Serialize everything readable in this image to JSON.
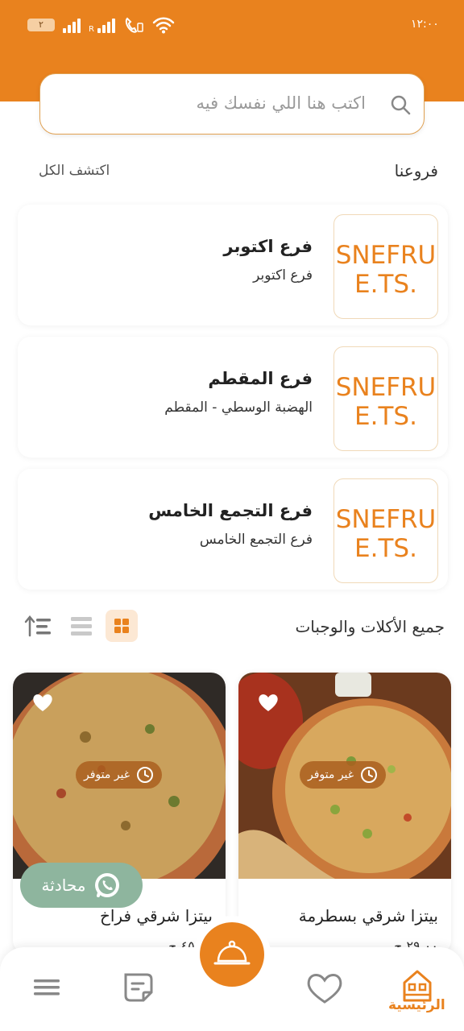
{
  "status_bar": {
    "time": "١٢:٠٠",
    "battery": "٢"
  },
  "search": {
    "placeholder": "اكتب هنا  اللي نفسك فيه"
  },
  "branches_section": {
    "title": "فروعنا",
    "see_all": "اكتشف الكل"
  },
  "branches": [
    {
      "name": "فرع اكتوبر",
      "address": "فرع اكتوبر",
      "logo_line1": "SNEFRU",
      "logo_line2": "E.TS."
    },
    {
      "name": "فرع المقطم",
      "address": "الهضبة الوسطي - المقطم",
      "logo_line1": "SNEFRU",
      "logo_line2": "E.TS."
    },
    {
      "name": "فرع التجمع الخامس",
      "address": "فرع التجمع الخامس",
      "logo_line1": "SNEFRU",
      "logo_line2": "E.TS."
    }
  ],
  "meals_section": {
    "title": "جميع الأكلات والوجبات"
  },
  "products": [
    {
      "name": "بيتزا شرقي بسطرمة",
      "availability": "غير متوفر",
      "price": "٢٩.٠٠ ج"
    },
    {
      "name": "بيتزا شرقي فراخ",
      "availability": "غير متوفر",
      "price": "٤٥.٠٠ ج"
    }
  ],
  "chat": {
    "label": "محادثة"
  },
  "bottom_nav": {
    "home_label": "الرئيسية"
  },
  "colors": {
    "accent": "#E9821E",
    "chat": "#8EB59E"
  }
}
